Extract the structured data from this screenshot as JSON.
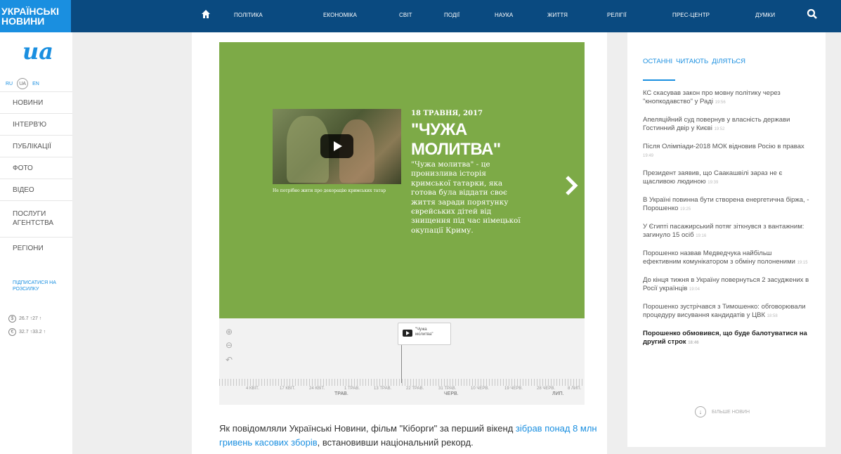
{
  "header": {
    "logo_line1": "УКРАЇНСЬКІ",
    "logo_line2": "НОВИНИ",
    "nav": [
      "ПОЛІТИКА",
      "ЕКОНОМІКА",
      "СВІТ",
      "ПОДІЇ",
      "НАУКА",
      "ЖИТТЯ",
      "РЕЛІГІЇ",
      "ПРЕС-ЦЕНТР",
      "ДУМКИ"
    ]
  },
  "sidebar": {
    "logo_text": "ua",
    "langs": [
      "RU",
      "UA",
      "EN"
    ],
    "items": [
      "НОВИНИ",
      "ІНТЕРВ'Ю",
      "ПУБЛІКАЦІЇ",
      "ФОТО",
      "ВІДЕО",
      "ПОСЛУГИ АГЕНТСТВА",
      "РЕГІОНИ"
    ],
    "subscribe": "ПІДПИСАТИСЯ НА РОЗСИЛКУ",
    "usd": "26.7 ↑27 ↑",
    "eur": "32.7 ↑33.2 ↑"
  },
  "story": {
    "date": "18 ТРАВНЯ, 2017",
    "title_line1": "\"ЧУЖА",
    "title_line2": "МОЛИТВА\"",
    "lead": "\"Чужа молитва\" - це пронизлива історія кримської татарки, яка готова була віддати своє життя заради порятунку єврейських дітей від знищення під час німецької окупації Криму.",
    "video_caption": "Не потрібно жити про декорацію кримських татар"
  },
  "timeline": {
    "card_text_1": "\"Чужа",
    "card_text_2": "молитва\"",
    "tick_labels": [
      "4 КВІТ.",
      "17 КВІТ.",
      "24 КВІТ.",
      "1 ТРАВ.",
      "13 ТРАВ.",
      "22 ТРАВ.",
      "31 ТРАВ.",
      "10 ЧЕРВ.",
      "19 ЧЕРВ.",
      "28 ЧЕРВ.",
      "8 ЛИП."
    ],
    "months": [
      "ТРАВ.",
      "ЧЕРВ.",
      "ЛИП."
    ]
  },
  "article": {
    "text_before": "Як повідомляли Українські Новини, фільм \"Кіборги\" за перший вікенд ",
    "link": "зібрав понад 8 млн гривень касових зборів",
    "text_after": ", встановивши національний рекорд."
  },
  "right": {
    "tabs": [
      "ОСТАННІ",
      "ЧИТАЮТЬ",
      "ДІЛЯТЬСЯ"
    ],
    "news": [
      {
        "text": "КС скасував закон про мовну політику через \"кнопкодавство\" у Раді",
        "time": "19:56"
      },
      {
        "text": "Апеляційний суд повернув у власність держави Гостинний двір у Києві",
        "time": "19:52"
      },
      {
        "text": "Після Олімпіади-2018 МОК відновив Росію в правах",
        "time": "19:49"
      },
      {
        "text": "Президент заявив, що Саакашвілі зараз не є щасливою людиною",
        "time": "19:39"
      },
      {
        "text": "В Україні повинна бути створена енергетична біржа, - Порошенко",
        "time": "19:25"
      },
      {
        "text": "У Єгипті пасажирський потяг зіткнувся з вантажним: загинуло 15 осіб",
        "time": "19:16"
      },
      {
        "text": "Порошенко назвав Медведчука найбільш ефективним комунікатором з обміну полоненими",
        "time": "19:15"
      },
      {
        "text": "До кінця тижня в Україну повернуться 2 засуджених в Росії українців",
        "time": "19:04"
      },
      {
        "text": "Порошенко зустрічався з Тимошенко: обговорювали процедуру висування кандидатів у ЦВК",
        "time": "18:58"
      },
      {
        "text": "Порошенко обмовився, що буде балотуватися на другий строк",
        "time": "18:46"
      }
    ],
    "more": "БІЛЬШЕ НОВИН"
  }
}
